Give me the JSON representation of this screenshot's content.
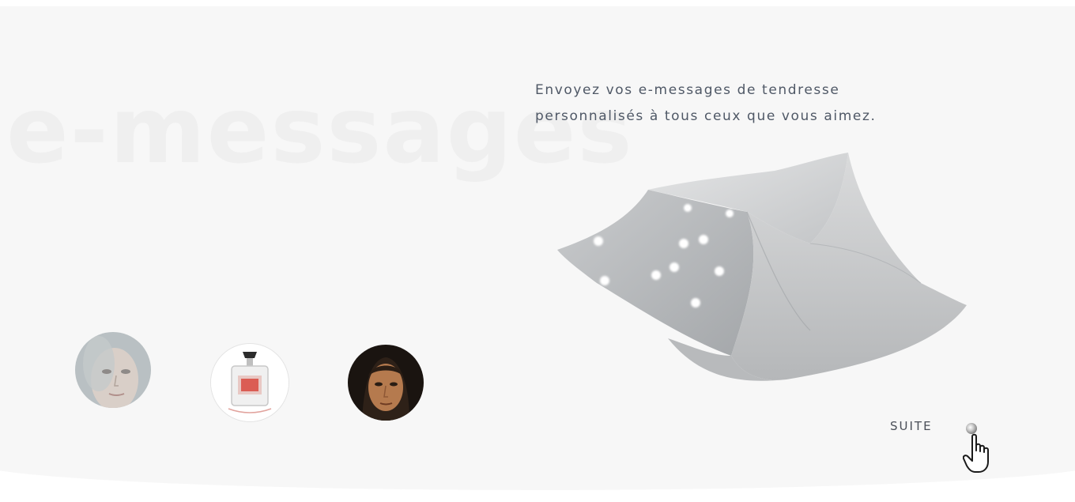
{
  "background_word": "e-messages",
  "tagline": {
    "line1": "Envoyez vos e-messages de tendresse",
    "line2": "personnalisés à tous ceux que vous aimez."
  },
  "illustration": {
    "icon": "star-scarf-illustration",
    "colors": {
      "fabric_light": "#d6d8da",
      "fabric_dark": "#a9acaf",
      "stars": "#ffffff"
    }
  },
  "choices": [
    {
      "icon": "woman-face-avatar"
    },
    {
      "icon": "perfume-bottle-avatar"
    },
    {
      "icon": "painted-portrait-avatar"
    }
  ],
  "navigation": {
    "suite_label": "SUITE",
    "suite_icon": "bullet-dot-icon",
    "cursor_icon": "hand-pointer-icon"
  },
  "colors": {
    "page_background": "#f7f7f7",
    "text": "#4f5866",
    "watermark": "#efefef"
  }
}
